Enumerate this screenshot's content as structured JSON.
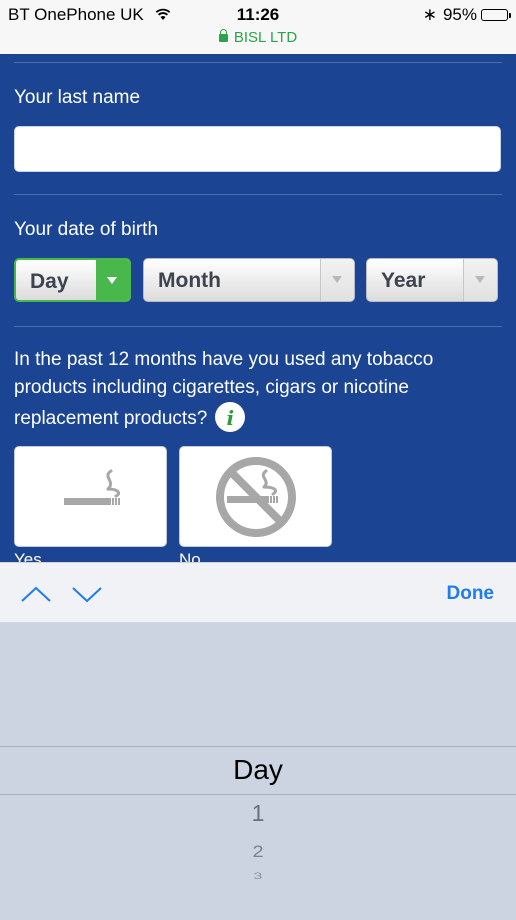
{
  "status_bar": {
    "carrier": "BT OnePhone UK",
    "time": "11:26",
    "site": "BISL LTD",
    "battery": "95%",
    "battery_level": 0.95
  },
  "form": {
    "last_name": {
      "label": "Your last name",
      "value": ""
    },
    "dob": {
      "label": "Your date of birth",
      "day": "Day",
      "month": "Month",
      "year": "Year",
      "focused": "day"
    },
    "tobacco_question": "In the past 12 months have you used any tobacco products including cigarettes, cigars or nicotine replacement products?",
    "choices": [
      {
        "icon": "cigarette-icon",
        "label": "Yes"
      },
      {
        "icon": "no-smoking-icon",
        "label": "No"
      }
    ]
  },
  "accessory": {
    "prev_icon": "chevron-up-icon",
    "next_icon": "chevron-down-icon",
    "done_label": "Done"
  },
  "picker": {
    "options": [
      "Day",
      "1",
      "2",
      "3"
    ],
    "selected": "Day"
  },
  "colors": {
    "form_bg": "#1b4592",
    "active_select": "#48b84d",
    "link_blue": "#1e7cf0",
    "secure_green": "#2aa34a"
  }
}
